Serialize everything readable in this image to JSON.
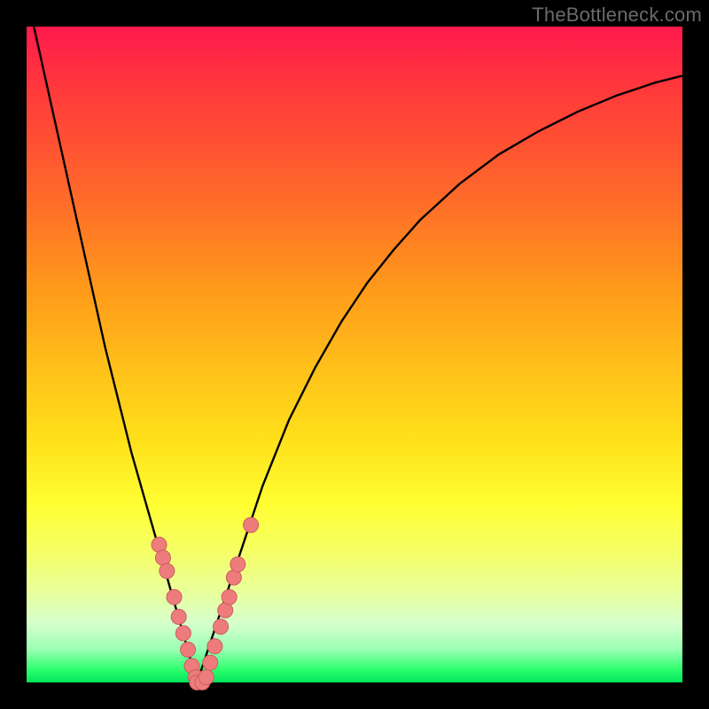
{
  "watermark": "TheBottleneck.com",
  "colors": {
    "curve_stroke": "#000000",
    "dot_fill": "#ef7c7c",
    "dot_stroke": "#c95e5e"
  },
  "chart_data": {
    "type": "line",
    "title": "",
    "xlabel": "",
    "ylabel": "",
    "xlim": [
      0,
      100
    ],
    "ylim": [
      0,
      100
    ],
    "series": [
      {
        "name": "bottleneck-curve",
        "x": [
          0,
          2,
          4,
          6,
          8,
          10,
          12,
          14,
          16,
          18,
          20,
          21,
          22,
          23,
          24,
          25,
          26,
          27,
          28,
          29,
          30,
          32,
          34,
          36,
          38,
          40,
          44,
          48,
          52,
          56,
          60,
          66,
          72,
          78,
          84,
          90,
          96,
          100
        ],
        "y": [
          105,
          96,
          87,
          78,
          69,
          60,
          51,
          43,
          35,
          28,
          21,
          17.5,
          14,
          10.5,
          7,
          3.5,
          0,
          3,
          6,
          9,
          12,
          18,
          24,
          30,
          35,
          40,
          48,
          55,
          61,
          66,
          70.5,
          76,
          80.5,
          84,
          87,
          89.5,
          91.5,
          92.5
        ]
      }
    ],
    "points": [
      {
        "x": 20.2,
        "y": 21
      },
      {
        "x": 20.8,
        "y": 19
      },
      {
        "x": 21.4,
        "y": 17
      },
      {
        "x": 22.5,
        "y": 13
      },
      {
        "x": 23.2,
        "y": 10
      },
      {
        "x": 23.9,
        "y": 7.5
      },
      {
        "x": 24.6,
        "y": 5
      },
      {
        "x": 25.2,
        "y": 2.5
      },
      {
        "x": 25.8,
        "y": 0.8
      },
      {
        "x": 26.0,
        "y": 0
      },
      {
        "x": 26.8,
        "y": 0
      },
      {
        "x": 27.4,
        "y": 0.8
      },
      {
        "x": 28.0,
        "y": 3
      },
      {
        "x": 28.7,
        "y": 5.5
      },
      {
        "x": 29.6,
        "y": 8.5
      },
      {
        "x": 30.3,
        "y": 11
      },
      {
        "x": 30.9,
        "y": 13
      },
      {
        "x": 31.6,
        "y": 16
      },
      {
        "x": 32.2,
        "y": 18
      },
      {
        "x": 34.2,
        "y": 24
      }
    ],
    "dot_radius_px": 8.5
  }
}
